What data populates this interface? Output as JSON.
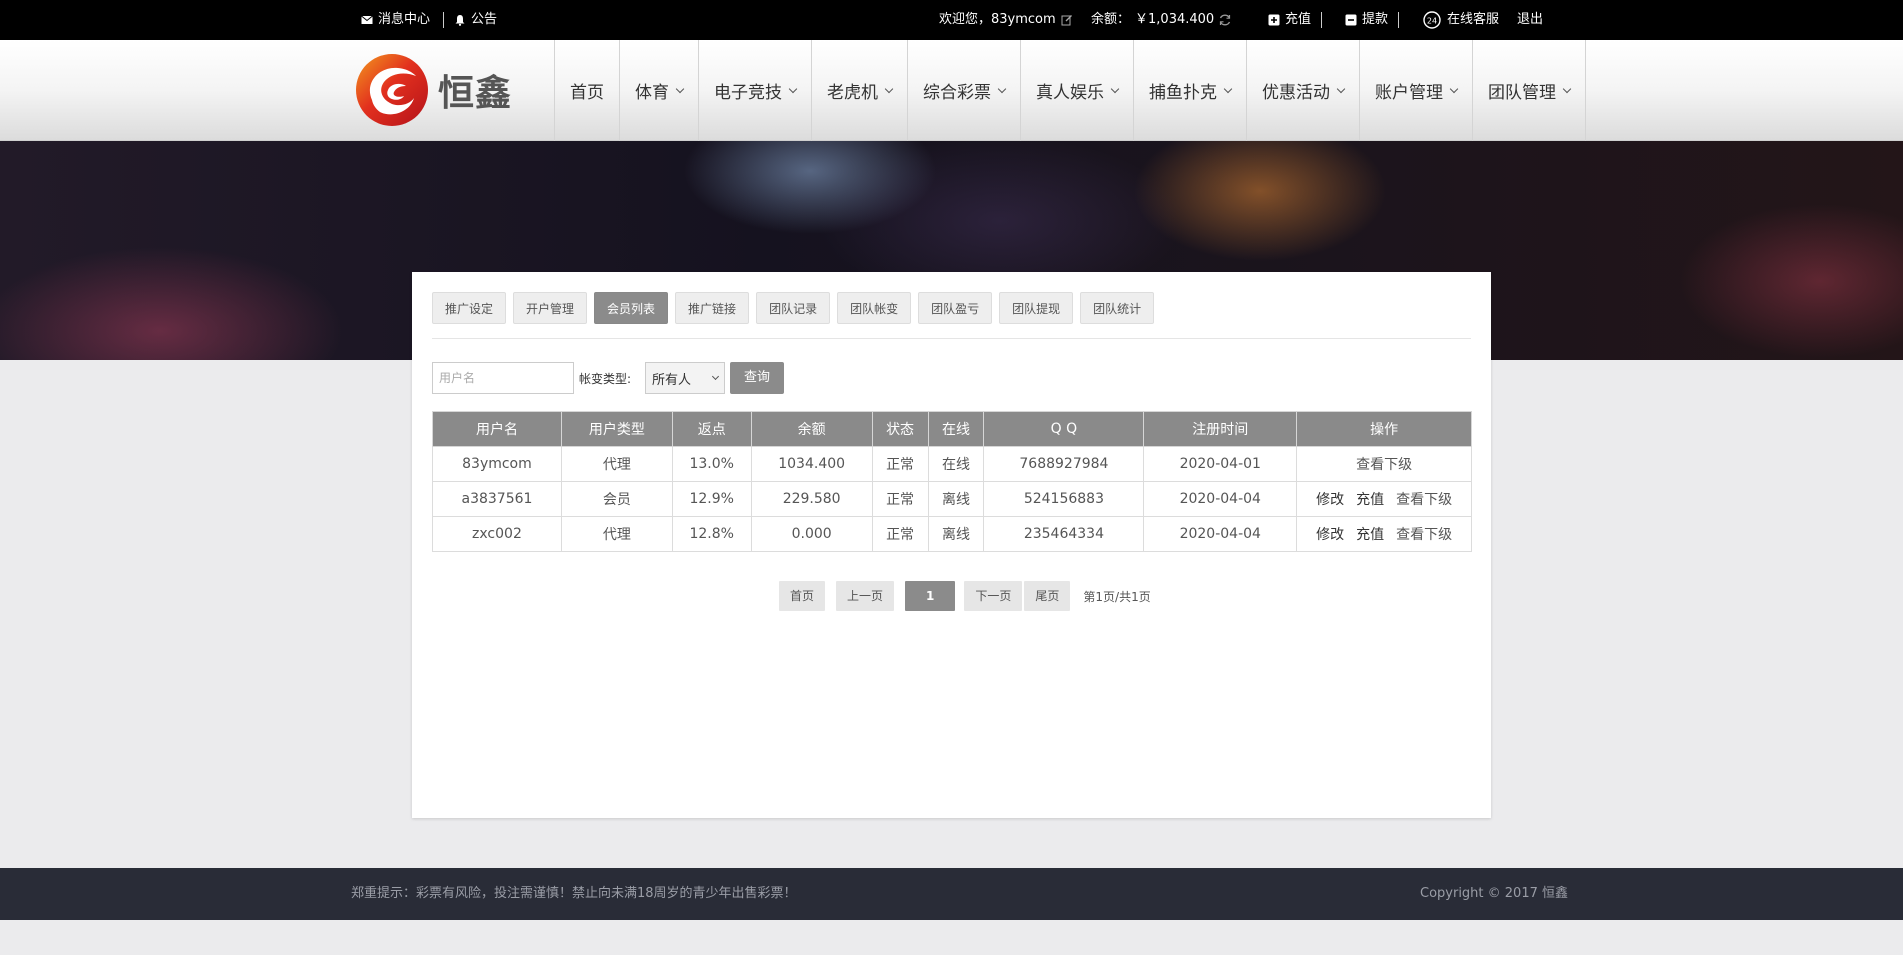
{
  "topbar": {
    "messages": "消息中心",
    "notice": "公告",
    "welcome": "欢迎您，83ymcom",
    "balance_label": "余额：",
    "balance_value": "￥1,034.400",
    "deposit": "充值",
    "withdraw": "提款",
    "support": "在线客服",
    "logout": "退出"
  },
  "logo": {
    "text": "恒鑫"
  },
  "nav": [
    {
      "label": "首页",
      "dropdown": false
    },
    {
      "label": "体育",
      "dropdown": true
    },
    {
      "label": "电子竞技",
      "dropdown": true
    },
    {
      "label": "老虎机",
      "dropdown": true
    },
    {
      "label": "综合彩票",
      "dropdown": true
    },
    {
      "label": "真人娱乐",
      "dropdown": true
    },
    {
      "label": "捕鱼扑克",
      "dropdown": true
    },
    {
      "label": "优惠活动",
      "dropdown": true
    },
    {
      "label": "账户管理",
      "dropdown": true
    },
    {
      "label": "团队管理",
      "dropdown": true
    }
  ],
  "tabs": [
    "推广设定",
    "开户管理",
    "会员列表",
    "推广链接",
    "团队记录",
    "团队帐变",
    "团队盈亏",
    "团队提现",
    "团队统计"
  ],
  "active_tab": 2,
  "filter": {
    "username_placeholder": "用户名",
    "type_label": "帐变类型:",
    "type_value": "所有人",
    "query_button": "查询"
  },
  "table": {
    "headers": [
      "用户名",
      "用户类型",
      "返点",
      "余额",
      "状态",
      "在线",
      "Q Q",
      "注册时间",
      "操作"
    ],
    "rows": [
      {
        "username": "83ymcom",
        "type": "代理",
        "rebate": "13.0%",
        "balance": "1034.400",
        "status": "正常",
        "online": "在线",
        "qq": "7688927984",
        "registered": "2020-04-01",
        "actions": [
          "查看下级"
        ]
      },
      {
        "username": "a3837561",
        "type": "会员",
        "rebate": "12.9%",
        "balance": "229.580",
        "status": "正常",
        "online": "离线",
        "qq": "524156883",
        "registered": "2020-04-04",
        "actions": [
          "修改",
          "充值",
          "查看下级"
        ]
      },
      {
        "username": "zxc002",
        "type": "代理",
        "rebate": "12.8%",
        "balance": "0.000",
        "status": "正常",
        "online": "离线",
        "qq": "235464334",
        "registered": "2020-04-04",
        "actions": [
          "修改",
          "充值",
          "查看下级"
        ]
      }
    ]
  },
  "pager": {
    "first": "首页",
    "prev": "上一页",
    "current": "1",
    "next": "下一页",
    "last": "尾页",
    "info": "第1页/共1页"
  },
  "footer": {
    "notice": "郑重提示：彩票有风险，投注需谨慎！禁止向未满18周岁的青少年出售彩票！",
    "copyright": "Copyright © 2017 恒鑫"
  },
  "colors": {
    "topbar": "#000000",
    "accent_gray": "#8b8b8b",
    "online_red": "#e00000",
    "footer": "#292c37"
  }
}
